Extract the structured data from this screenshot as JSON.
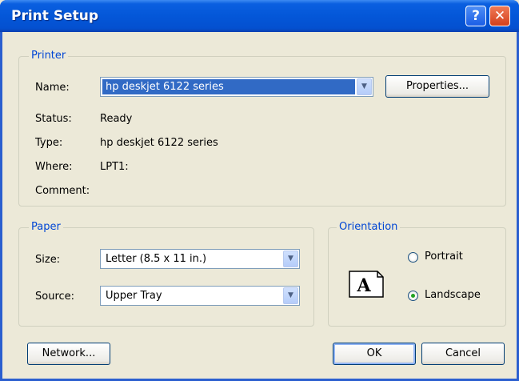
{
  "window": {
    "title": "Print Setup",
    "help_icon": "?",
    "close_icon": "✕"
  },
  "printer": {
    "legend": "Printer",
    "name_label": "Name:",
    "name_value": "hp deskjet 6122 series",
    "properties_button": "Properties...",
    "status_label": "Status:",
    "status_value": "Ready",
    "type_label": "Type:",
    "type_value": "hp deskjet 6122 series",
    "where_label": "Where:",
    "where_value": "LPT1:",
    "comment_label": "Comment:",
    "comment_value": ""
  },
  "paper": {
    "legend": "Paper",
    "size_label": "Size:",
    "size_value": "Letter (8.5 x 11 in.)",
    "source_label": "Source:",
    "source_value": "Upper Tray"
  },
  "orientation": {
    "legend": "Orientation",
    "portrait_label": "Portrait",
    "landscape_label": "Landscape",
    "selected": "Landscape",
    "preview_letter": "A"
  },
  "buttons": {
    "network": "Network...",
    "ok": "OK",
    "cancel": "Cancel"
  },
  "colors": {
    "title_bar": "#0457d8",
    "group_label": "#0046d5",
    "selection": "#316ac5"
  }
}
